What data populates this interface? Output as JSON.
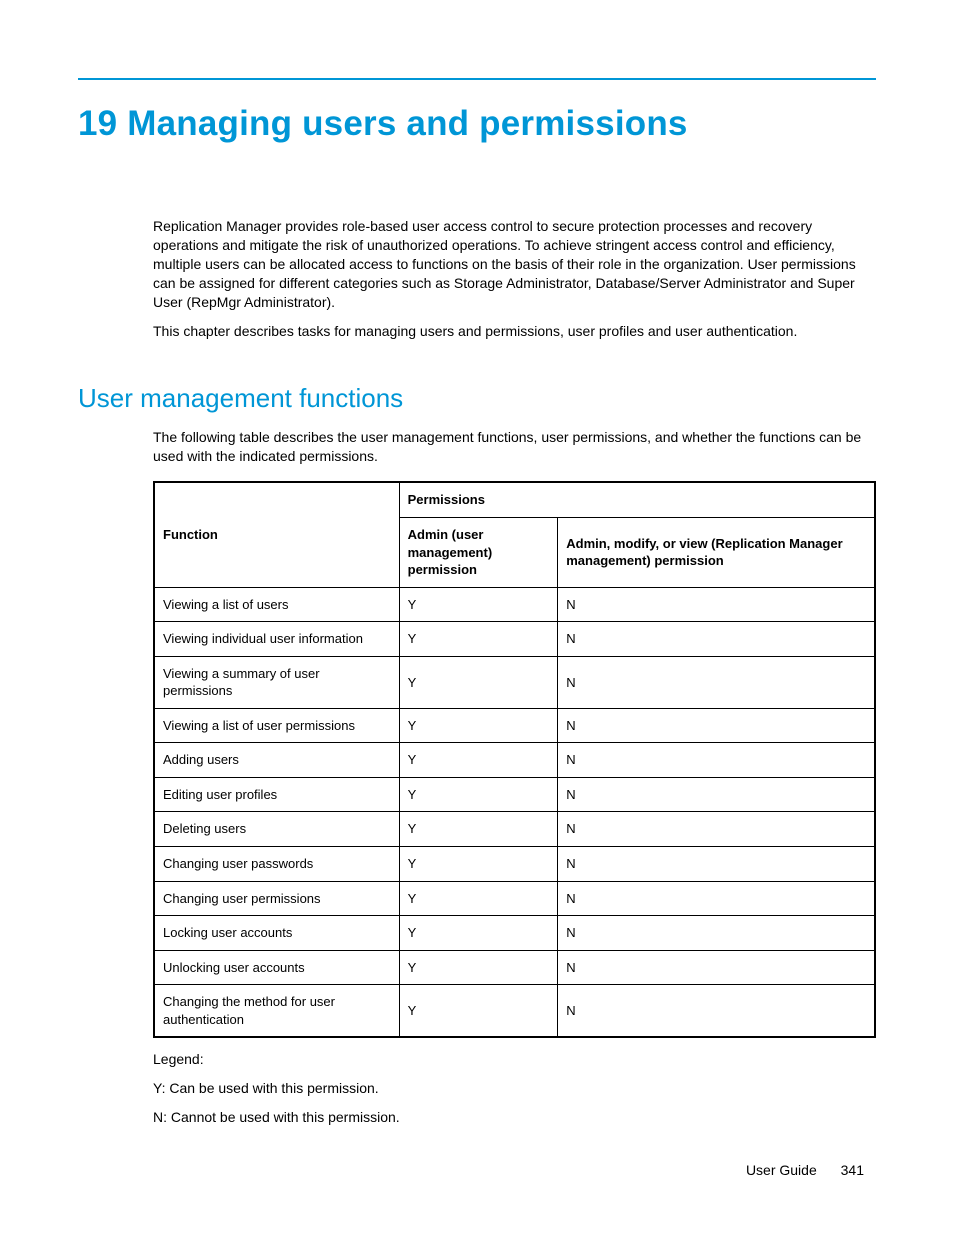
{
  "chapter": {
    "title": "19 Managing users and permissions",
    "intro_para_1": "Replication Manager provides role-based user access control to secure protection processes and recovery operations and mitigate the risk of unauthorized operations. To achieve stringent access control and efficiency, multiple users can be allocated access to functions on the basis of their role in the organization. User permissions can be assigned for different categories such as Storage Administrator, Database/Server Administrator and Super User (RepMgr Administrator).",
    "intro_para_2": "This chapter describes tasks for managing users and permissions, user profiles and user authentication."
  },
  "section": {
    "title": "User management functions",
    "intro": "The following table describes the user management functions, user permissions, and whether the functions can be used with the indicated permissions."
  },
  "table": {
    "header": {
      "function": "Function",
      "permissions_group": "Permissions",
      "col_admin_user": "Admin (user management) permission",
      "col_admin_mod_view": "Admin, modify, or view (Replication Manager management) permission"
    },
    "rows": [
      {
        "fn": "Viewing a list of users",
        "p1": "Y",
        "p2": "N"
      },
      {
        "fn": "Viewing individual user information",
        "p1": "Y",
        "p2": "N"
      },
      {
        "fn": "Viewing a summary of user permissions",
        "p1": "Y",
        "p2": "N"
      },
      {
        "fn": "Viewing a list of user permissions",
        "p1": "Y",
        "p2": "N"
      },
      {
        "fn": "Adding users",
        "p1": "Y",
        "p2": "N"
      },
      {
        "fn": "Editing user profiles",
        "p1": "Y",
        "p2": "N"
      },
      {
        "fn": "Deleting users",
        "p1": "Y",
        "p2": "N"
      },
      {
        "fn": "Changing user passwords",
        "p1": "Y",
        "p2": "N"
      },
      {
        "fn": "Changing user permissions",
        "p1": "Y",
        "p2": "N"
      },
      {
        "fn": "Locking user accounts",
        "p1": "Y",
        "p2": "N"
      },
      {
        "fn": "Unlocking user accounts",
        "p1": "Y",
        "p2": "N"
      },
      {
        "fn": "Changing the method for user authentication",
        "p1": "Y",
        "p2": "N"
      }
    ]
  },
  "legend": {
    "title": "Legend:",
    "y": "Y: Can be used with this permission.",
    "n": "N: Cannot be used with this permission."
  },
  "footer": {
    "doc_name": "User Guide",
    "page_number": "341"
  }
}
